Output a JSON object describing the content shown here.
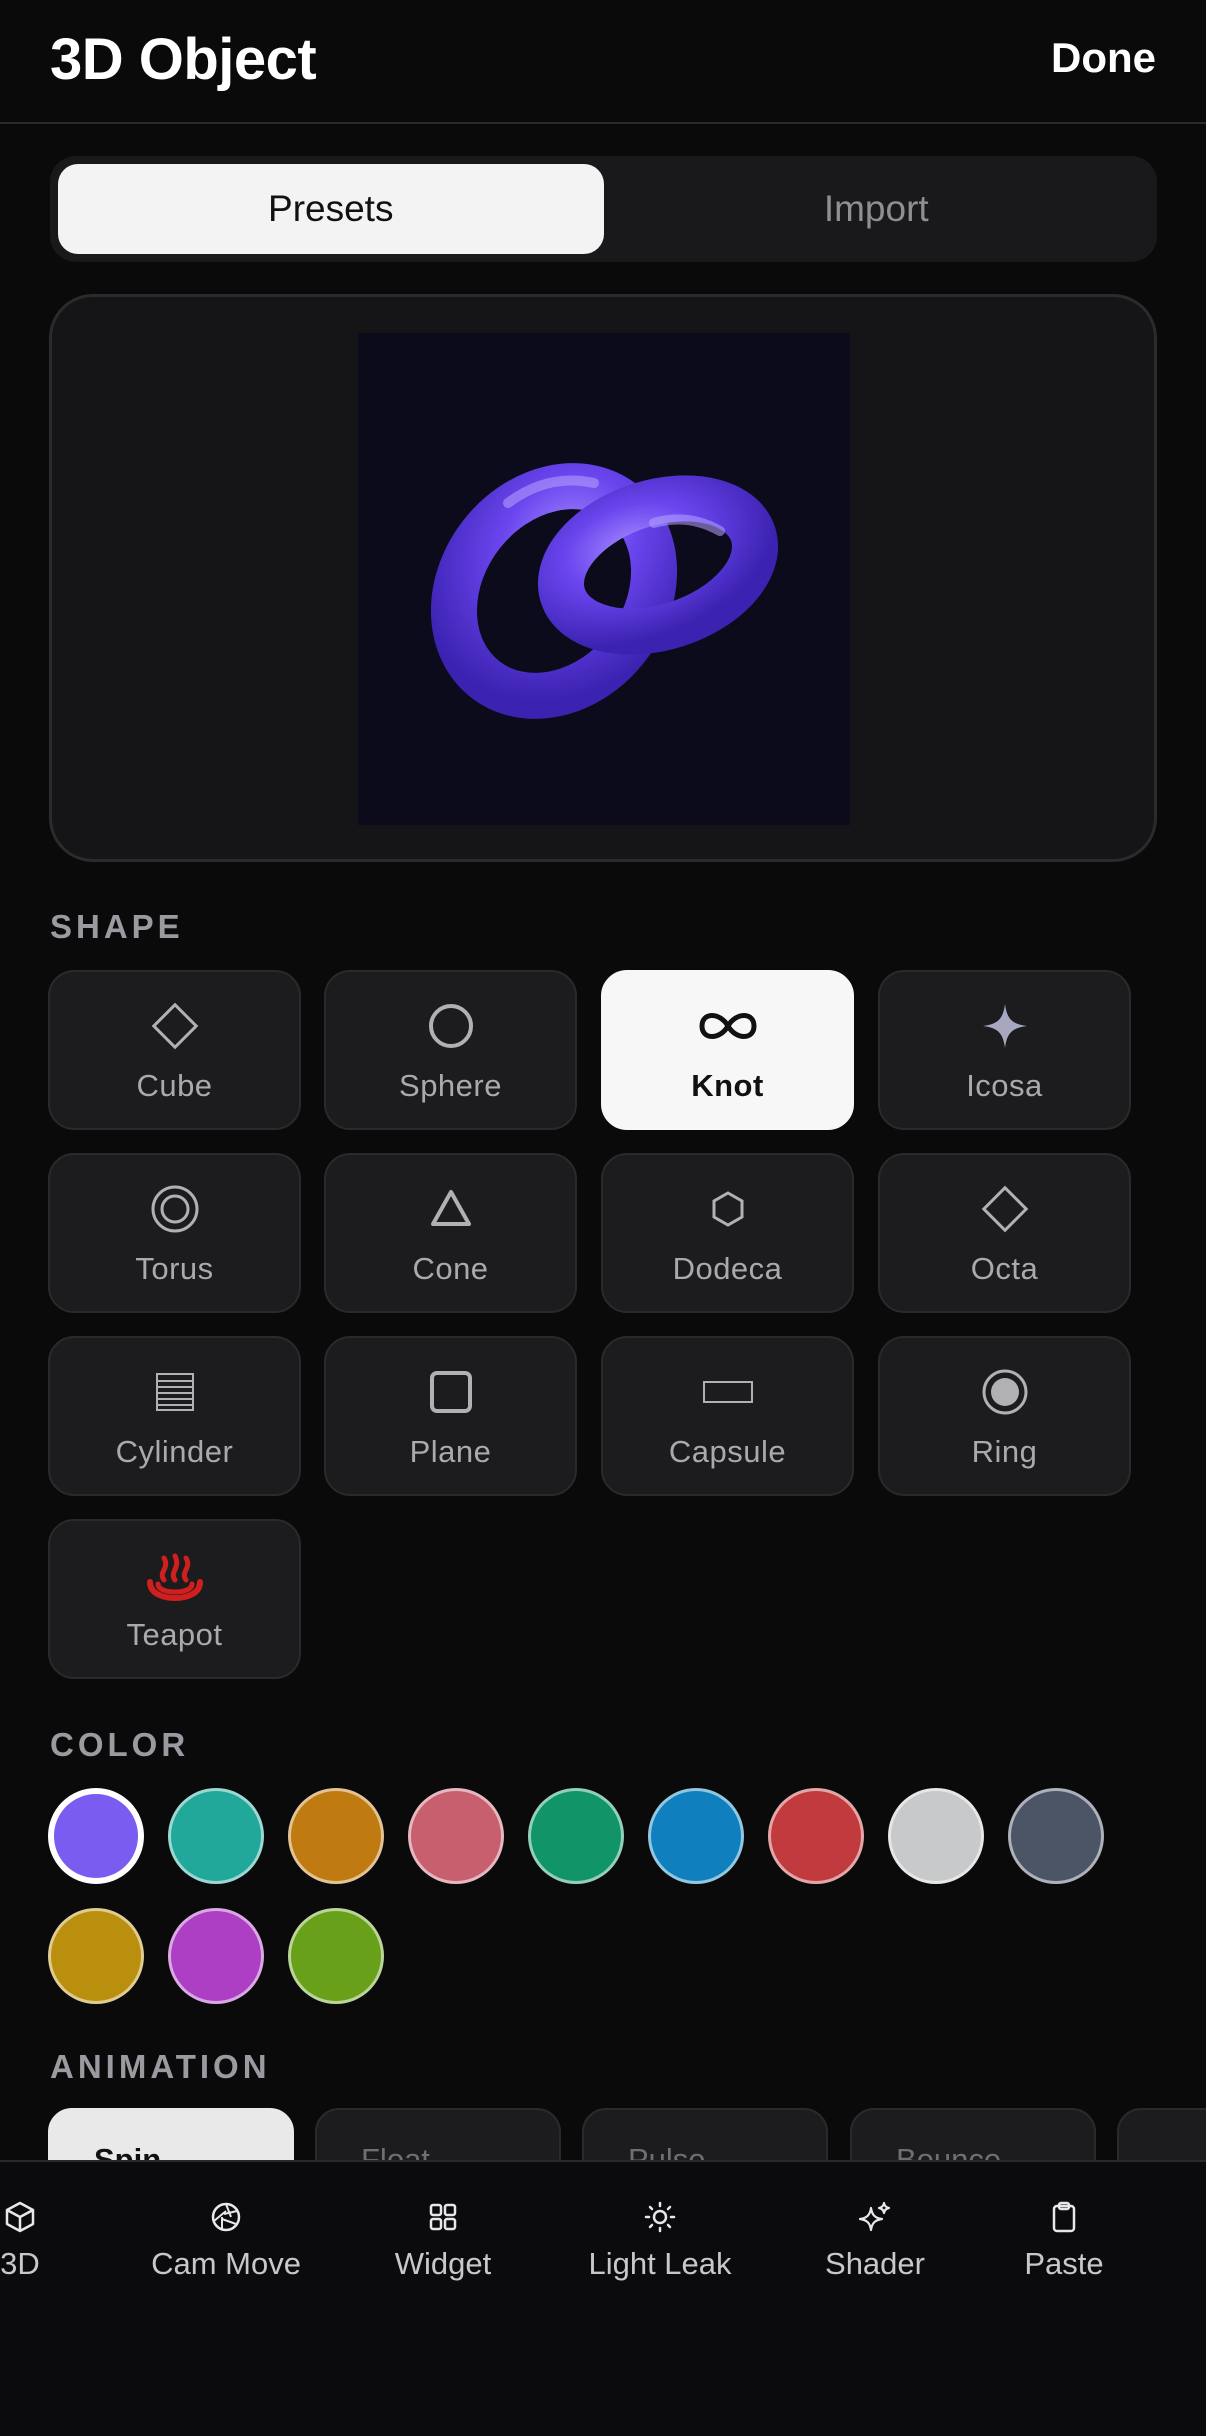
{
  "header": {
    "title": "3D Object",
    "done_label": "Done"
  },
  "segmented": {
    "presets_label": "Presets",
    "import_label": "Import",
    "selected": "Presets"
  },
  "preview": {
    "object_color": "#7b5cf0",
    "background": "#0c0b1c"
  },
  "shape": {
    "section_label": "SHAPE",
    "selected": "Knot",
    "items": [
      {
        "label": "Cube",
        "icon": "diamond-outline-icon"
      },
      {
        "label": "Sphere",
        "icon": "circle-outline-icon"
      },
      {
        "label": "Knot",
        "icon": "infinity-icon"
      },
      {
        "label": "Icosa",
        "icon": "sparkle-icon"
      },
      {
        "label": "Torus",
        "icon": "ring-circle-icon"
      },
      {
        "label": "Cone",
        "icon": "triangle-icon"
      },
      {
        "label": "Dodeca",
        "icon": "hexagon-icon"
      },
      {
        "label": "Octa",
        "icon": "diamond-outline-icon"
      },
      {
        "label": "Cylinder",
        "icon": "stripes-square-icon"
      },
      {
        "label": "Plane",
        "icon": "square-outline-icon"
      },
      {
        "label": "Capsule",
        "icon": "rectangle-icon"
      },
      {
        "label": "Ring",
        "icon": "radio-circle-icon"
      },
      {
        "label": "Teapot",
        "icon": "hot-springs-icon"
      }
    ]
  },
  "color": {
    "section_label": "COLOR",
    "selected_index": 0,
    "swatches": [
      "#7b5cf0",
      "#22a89a",
      "#c07a12",
      "#c85f6f",
      "#119467",
      "#0f80bd",
      "#c13a3d",
      "#c8c9cb",
      "#4b5566",
      "#b98f0d",
      "#ad3fc4",
      "#69a01a"
    ]
  },
  "animation": {
    "section_label": "ANIMATION",
    "chips": [
      {
        "label": "Spin",
        "selected": true
      },
      {
        "label": "Float",
        "selected": false
      },
      {
        "label": "Pulse",
        "selected": false
      },
      {
        "label": "Bounce",
        "selected": false
      },
      {
        "label": "",
        "selected": false
      }
    ]
  },
  "bottom_bar": {
    "items": [
      {
        "label": "3D",
        "icon": "cube-icon"
      },
      {
        "label": "Cam Move",
        "icon": "aperture-icon"
      },
      {
        "label": "Widget",
        "icon": "grid-icon"
      },
      {
        "label": "Light Leak",
        "icon": "sun-icon"
      },
      {
        "label": "Shader",
        "icon": "sparkles-icon"
      },
      {
        "label": "Paste",
        "icon": "clipboard-icon"
      }
    ]
  }
}
